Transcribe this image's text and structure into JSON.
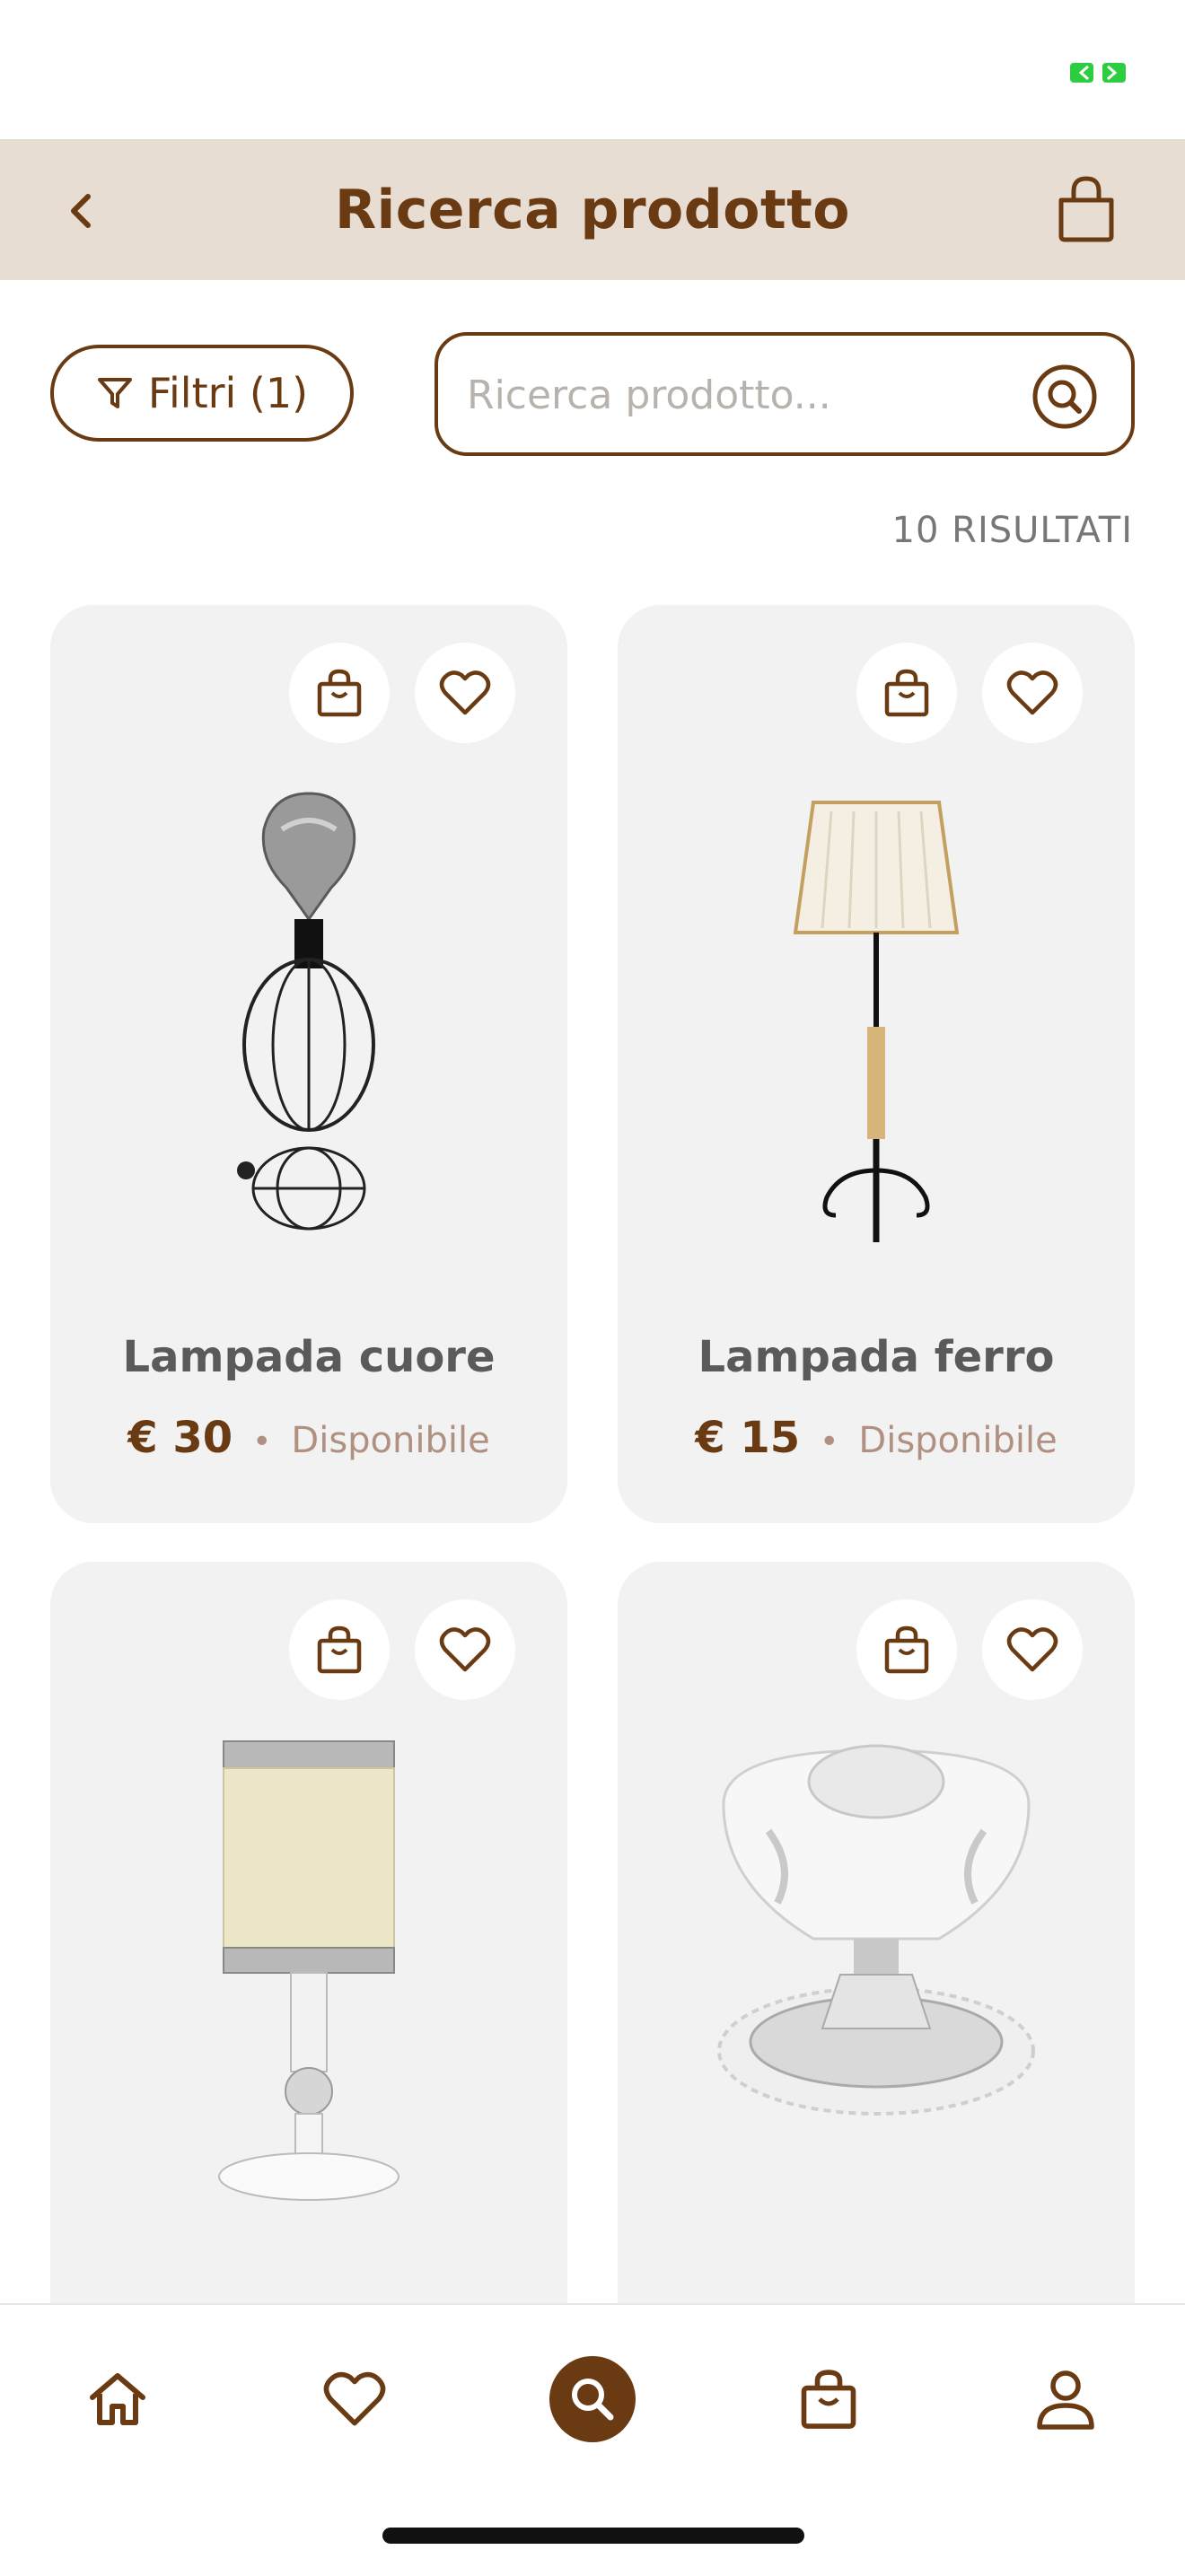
{
  "header": {
    "title": "Ricerca prodotto"
  },
  "filters": {
    "label": "Filtri (1)"
  },
  "search": {
    "placeholder": "Ricerca prodotto...",
    "value": ""
  },
  "results": {
    "count_label": "10 RISULTATI"
  },
  "products": [
    {
      "name": "Lampada cuore",
      "price": "€ 30",
      "availability": "Disponibile"
    },
    {
      "name": "Lampada ferro",
      "price": "€ 15",
      "availability": "Disponibile"
    },
    {
      "name": "",
      "price": "",
      "availability": ""
    },
    {
      "name": "",
      "price": "",
      "availability": ""
    }
  ],
  "tabs": [
    "home-icon",
    "heart-icon",
    "search-icon",
    "shopping-bag-icon",
    "user-icon"
  ],
  "colors": {
    "accent": "#6a3a12",
    "header_bg": "#e8ddd3",
    "card_bg": "#f2f2f2",
    "muted": "#b09080",
    "battery": "#2ecc40"
  }
}
